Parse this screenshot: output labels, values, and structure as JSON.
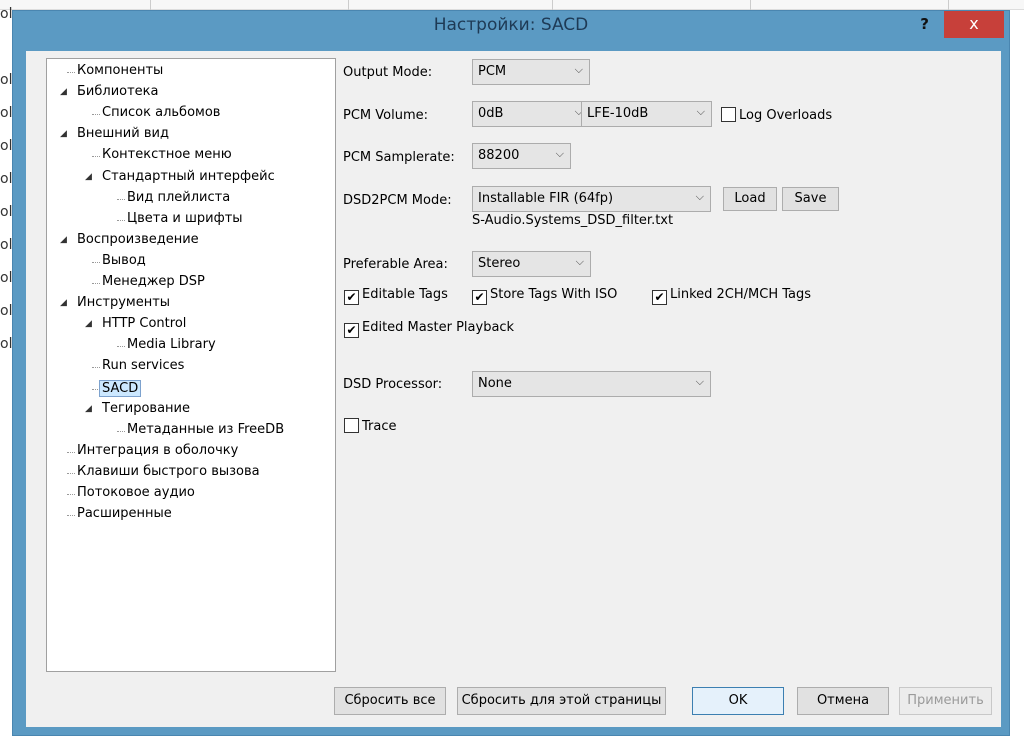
{
  "background_fragments": [
    "ol",
    "ol",
    "ol",
    "ol",
    "ol",
    "ol",
    "ol",
    "ol",
    "ol",
    "ol"
  ],
  "window": {
    "title": "Настройки: SACD",
    "help": "?",
    "close": "x"
  },
  "tree": [
    {
      "label": "Компоненты",
      "level": 0,
      "expander": false
    },
    {
      "label": "Библиотека",
      "level": 0,
      "expander": true
    },
    {
      "label": "Список альбомов",
      "level": 1,
      "expander": false
    },
    {
      "label": "Внешний вид",
      "level": 0,
      "expander": true
    },
    {
      "label": "Контекстное меню",
      "level": 1,
      "expander": false
    },
    {
      "label": "Стандартный интерфейс",
      "level": 1,
      "expander": true
    },
    {
      "label": "Вид плейлиста",
      "level": 2,
      "expander": false
    },
    {
      "label": "Цвета и шрифты",
      "level": 2,
      "expander": false
    },
    {
      "label": "Воспроизведение",
      "level": 0,
      "expander": true
    },
    {
      "label": "Вывод",
      "level": 1,
      "expander": false
    },
    {
      "label": "Менеджер DSP",
      "level": 1,
      "expander": false
    },
    {
      "label": "Инструменты",
      "level": 0,
      "expander": true
    },
    {
      "label": "HTTP Control",
      "level": 1,
      "expander": true
    },
    {
      "label": "Media Library",
      "level": 2,
      "expander": false
    },
    {
      "label": "Run services",
      "level": 1,
      "expander": false
    },
    {
      "label": "SACD",
      "level": 1,
      "expander": false,
      "selected": true
    },
    {
      "label": "Тегирование",
      "level": 1,
      "expander": true
    },
    {
      "label": "Метаданные из FreeDB",
      "level": 2,
      "expander": false
    },
    {
      "label": "Интеграция в оболочку",
      "level": 0,
      "expander": false
    },
    {
      "label": "Клавиши быстрого вызова",
      "level": 0,
      "expander": false
    },
    {
      "label": "Потоковое аудио",
      "level": 0,
      "expander": false
    },
    {
      "label": "Расширенные",
      "level": 0,
      "expander": false
    }
  ],
  "settings": {
    "output_mode": {
      "label": "Output Mode:",
      "value": "PCM"
    },
    "pcm_volume": {
      "label": "PCM Volume:",
      "value": "0dB",
      "lfe": "LFE-10dB"
    },
    "log_overloads": {
      "label": "Log Overloads",
      "checked": false
    },
    "pcm_samplerate": {
      "label": "PCM Samplerate:",
      "value": "88200"
    },
    "dsd2pcm": {
      "label": "DSD2PCM Mode:",
      "value": "Installable FIR (64fp)",
      "file": "S-Audio.Systems_DSD_filter.txt",
      "load": "Load",
      "save": "Save"
    },
    "preferable_area": {
      "label": "Preferable Area:",
      "value": "Stereo"
    },
    "editable_tags": {
      "label": "Editable Tags",
      "checked": true
    },
    "store_tags": {
      "label": "Store Tags With ISO",
      "checked": true
    },
    "linked_tags": {
      "label": "Linked 2CH/MCH Tags",
      "checked": true
    },
    "edited_master": {
      "label": "Edited Master Playback",
      "checked": true
    },
    "dsd_processor": {
      "label": "DSD Processor:",
      "value": "None"
    },
    "trace": {
      "label": "Trace",
      "checked": false
    }
  },
  "buttons": {
    "reset_all": "Сбросить все",
    "reset_page": "Сбросить для этой страницы",
    "ok": "OK",
    "cancel": "Отмена",
    "apply": "Применить"
  }
}
